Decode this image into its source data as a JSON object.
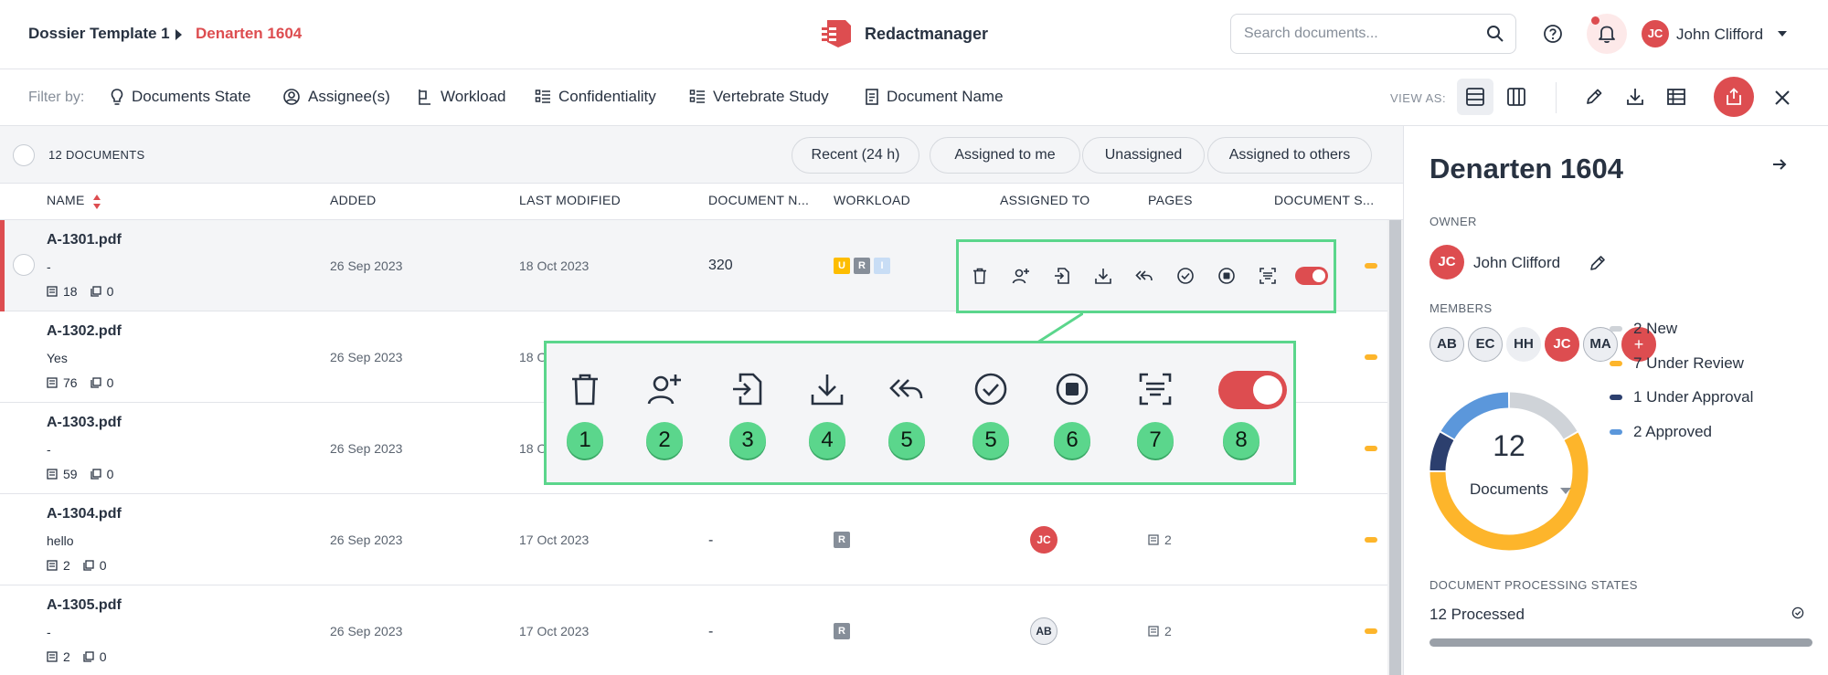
{
  "breadcrumb": {
    "template": "Dossier Template 1",
    "dossier": "Denarten 1604"
  },
  "app": {
    "name": "Redactmanager",
    "brand_color": "#dd4d50"
  },
  "search": {
    "placeholder": "Search documents..."
  },
  "user": {
    "initials": "JC",
    "name": "John Clifford"
  },
  "filters": {
    "label": "Filter by:",
    "items": [
      "Documents State",
      "Assignee(s)",
      "Workload",
      "Confidentiality",
      "Vertebrate Study",
      "Document Name"
    ]
  },
  "view": {
    "label": "VIEW AS:"
  },
  "quick": {
    "count": "12 DOCUMENTS",
    "pills": [
      "Recent (24 h)",
      "Assigned to me",
      "Unassigned",
      "Assigned to others"
    ]
  },
  "columns": [
    "NAME",
    "ADDED",
    "LAST MODIFIED",
    "DOCUMENT N...",
    "WORKLOAD",
    "ASSIGNED TO",
    "PAGES",
    "DOCUMENT S..."
  ],
  "rows": [
    {
      "name": "A-1301.pdf",
      "sub": "-",
      "pages_meta": "18",
      "annotations_meta": "0",
      "added": "26 Sep 2023",
      "modified": "18 Oct 2023",
      "docnum": "320",
      "workload": [
        "U",
        "R",
        "I"
      ],
      "assignee": "",
      "pages": ""
    },
    {
      "name": "A-1302.pdf",
      "sub": "Yes",
      "pages_meta": "76",
      "annotations_meta": "0",
      "added": "26 Sep 2023",
      "modified": "18 O",
      "docnum": "",
      "workload": [],
      "assignee": "",
      "pages": ""
    },
    {
      "name": "A-1303.pdf",
      "sub": "-",
      "pages_meta": "59",
      "annotations_meta": "0",
      "added": "26 Sep 2023",
      "modified": "18 O",
      "docnum": "",
      "workload": [],
      "assignee": "",
      "pages": ""
    },
    {
      "name": "A-1304.pdf",
      "sub": "hello",
      "pages_meta": "2",
      "annotations_meta": "0",
      "added": "26 Sep 2023",
      "modified": "17 Oct 2023",
      "docnum": "-",
      "workload": [
        "R"
      ],
      "assignee": "JC",
      "pages": "2"
    },
    {
      "name": "A-1305.pdf",
      "sub": "-",
      "pages_meta": "2",
      "annotations_meta": "0",
      "added": "26 Sep 2023",
      "modified": "17 Oct 2023",
      "docnum": "-",
      "workload": [
        "R"
      ],
      "assignee": "AB",
      "pages": "2"
    }
  ],
  "row_actions": [
    "trash-icon",
    "assign-user-icon",
    "import-icon",
    "download-icon",
    "reply-all-icon",
    "check-circle-icon",
    "stop-circle-icon",
    "ocr-scan-icon",
    "toggle"
  ],
  "callout": {
    "numbers": [
      "1",
      "2",
      "3",
      "4",
      "5",
      "5",
      "6",
      "7",
      "8"
    ],
    "color": "#5bd68c"
  },
  "panel": {
    "title": "Denarten 1604",
    "owner_label": "OWNER",
    "owner": {
      "initials": "JC",
      "name": "John Clifford"
    },
    "members_label": "MEMBERS",
    "members": [
      "AB",
      "EC",
      "HH",
      "JC",
      "MA"
    ],
    "add_member": "+",
    "processing_label": "DOCUMENT PROCESSING STATES",
    "processed": "12 Processed",
    "processed_fraction": 1.0
  },
  "chart_data": {
    "type": "pie",
    "total": "12",
    "center_label": "Documents",
    "slices": [
      {
        "label": "2 New",
        "value": 2,
        "color": "#cfd3d8"
      },
      {
        "label": "7 Under Review",
        "value": 7,
        "color": "#fdb52b"
      },
      {
        "label": "1 Under Approval",
        "value": 1,
        "color": "#2c3f6e"
      },
      {
        "label": "2 Approved",
        "value": 2,
        "color": "#5b97db"
      }
    ]
  }
}
